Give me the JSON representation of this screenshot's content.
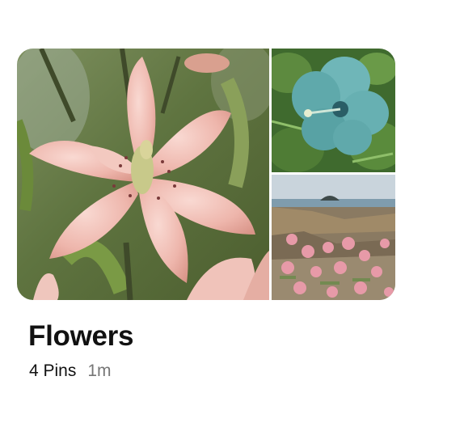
{
  "board": {
    "title": "Flowers",
    "pin_count": "4 Pins",
    "updated": "1m",
    "cover_images": [
      {
        "subject": "pink lily",
        "icon": "pink-lily-image"
      },
      {
        "subject": "blue hibiscus",
        "icon": "blue-hibiscus-image"
      },
      {
        "subject": "pink sea thrift on coastal rocks",
        "icon": "coastal-thrift-image"
      }
    ]
  },
  "colors": {
    "title": "#111111",
    "meta_primary": "#111111",
    "meta_secondary": "#767676",
    "background": "#ffffff"
  }
}
